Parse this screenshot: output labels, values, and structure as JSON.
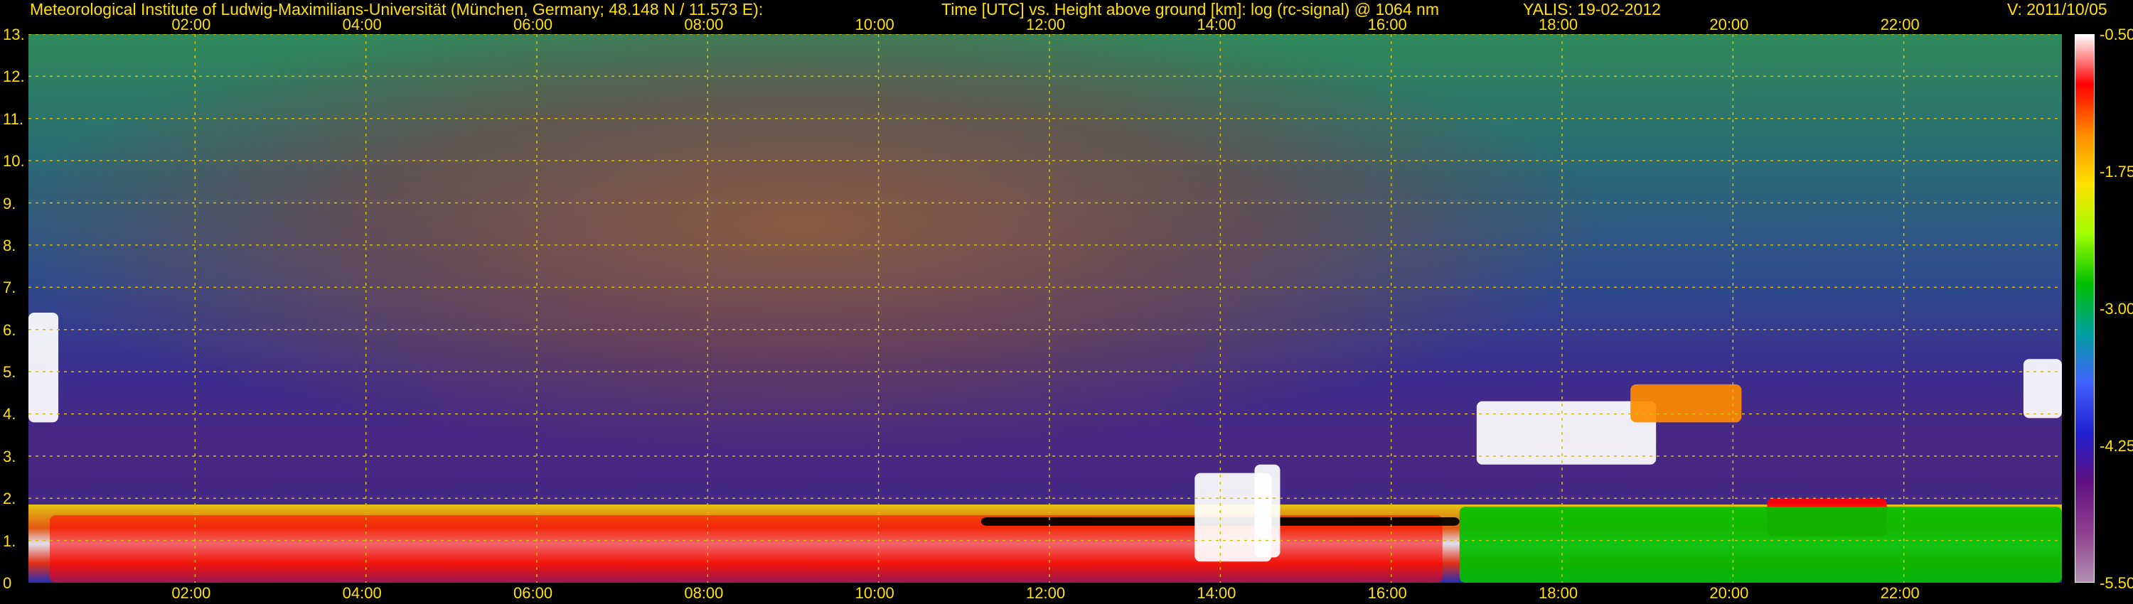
{
  "header": {
    "institute": "Meteorological Institute of Ludwig-Maximilians-Universität (München, Germany; 48.148 N / 11.573 E):",
    "axis_description": "Time [UTC] vs. Height above ground [km]: log (rc-signal) @ 1064 nm",
    "instrument_date": "YALIS: 19-02-2012",
    "version": "V: 2011/10/05"
  },
  "chart_data": {
    "type": "heatmap",
    "title": "Time [UTC] vs. Height above ground [km]: log (rc-signal) @ 1064 nm",
    "x_ticks": [
      "02:00",
      "04:00",
      "06:00",
      "08:00",
      "10:00",
      "12:00",
      "14:00",
      "16:00",
      "18:00",
      "20:00",
      "22:00"
    ],
    "x_tick_hours": [
      2,
      4,
      6,
      8,
      10,
      12,
      14,
      16,
      18,
      20,
      22
    ],
    "xlim_hours": [
      0.05,
      23.85
    ],
    "y_ticks": [
      "0",
      "1.",
      "2.",
      "3.",
      "4.",
      "5.",
      "6.",
      "7.",
      "8.",
      "9.",
      "10.",
      "11.",
      "12.",
      "13."
    ],
    "ylim_km": [
      0,
      13
    ],
    "grid": true,
    "colorbar": {
      "ticks": [
        "-0.50",
        "-1.75",
        "-3.00",
        "-4.25",
        "-5.50"
      ],
      "tick_values": [
        -0.5,
        -1.75,
        -3.0,
        -4.25,
        -5.5
      ],
      "range": [
        -5.5,
        -0.5
      ],
      "colors": [
        "#ffffff",
        "#ff0000",
        "#ff8c00",
        "#ffe000",
        "#a0ff00",
        "#00c000",
        "#00a0a0",
        "#4060ff",
        "#2020d0",
        "#601080",
        "#904090",
        "#b090b0"
      ]
    },
    "layers": [
      {
        "feature": "boundary layer",
        "hours": [
          0.3,
          16.6
        ],
        "height_km": [
          0.0,
          1.6
        ],
        "log_signal": -0.8
      },
      {
        "feature": "boundary layer top (dark band)",
        "hours": [
          11.2,
          16.8
        ],
        "height_km": [
          1.35,
          1.55
        ],
        "log_signal": -5.5
      },
      {
        "feature": "aerosol plume",
        "hours": [
          13.7,
          14.6
        ],
        "height_km": [
          0.5,
          2.6
        ],
        "log_signal": -0.6
      },
      {
        "feature": "aerosol plume",
        "hours": [
          14.4,
          14.7
        ],
        "height_km": [
          0.6,
          2.8
        ],
        "log_signal": -0.7
      },
      {
        "feature": "low cloud",
        "hours": [
          0.05,
          0.4
        ],
        "height_km": [
          3.8,
          6.4
        ],
        "log_signal": -0.5
      },
      {
        "feature": "low cloud",
        "hours": [
          23.4,
          23.85
        ],
        "height_km": [
          3.9,
          5.3
        ],
        "log_signal": -0.5
      },
      {
        "feature": "mid-level cloud",
        "hours": [
          17.0,
          19.1
        ],
        "height_km": [
          2.8,
          4.3
        ],
        "log_signal": -0.5
      },
      {
        "feature": "mid-level cloud",
        "hours": [
          18.8,
          20.1
        ],
        "height_km": [
          3.8,
          4.7
        ],
        "log_signal": -1.3
      },
      {
        "feature": "mid-level cloud",
        "hours": [
          20.4,
          21.8
        ],
        "height_km": [
          1.1,
          2.0
        ],
        "log_signal": -1.0
      },
      {
        "feature": "night residual layer",
        "hours": [
          16.8,
          23.85
        ],
        "height_km": [
          0.0,
          1.8
        ],
        "log_signal": -2.6
      }
    ]
  }
}
